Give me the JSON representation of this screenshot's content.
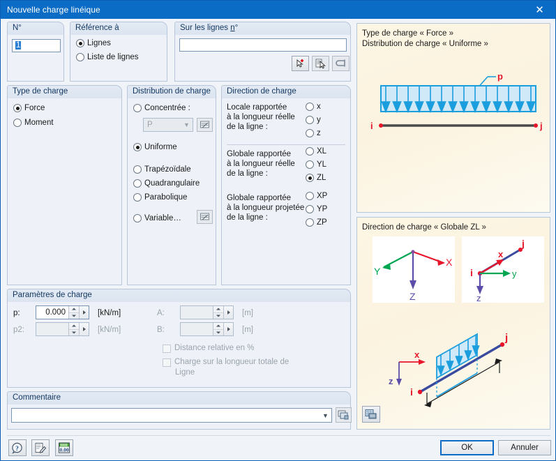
{
  "window": {
    "title": "Nouvelle charge linéique",
    "close_icon": "close-icon"
  },
  "groups": {
    "number": {
      "title": "N°",
      "value": "1"
    },
    "reference": {
      "title": "Référence à",
      "options": [
        {
          "label": "Lignes",
          "selected": true
        },
        {
          "label": "Liste de lignes",
          "selected": false
        }
      ]
    },
    "on_lines": {
      "title": "Sur les lignes n°",
      "value": "",
      "tools": [
        {
          "icon": "pick-new-line-icon"
        },
        {
          "icon": "pick-line-from-list-icon"
        },
        {
          "icon": "select-chain-icon"
        }
      ]
    },
    "load_type": {
      "title": "Type de charge",
      "options": [
        {
          "label": "Force",
          "selected": true
        },
        {
          "label": "Moment",
          "selected": false
        }
      ]
    },
    "load_distribution": {
      "title": "Distribution de charge",
      "options": [
        {
          "label": "Concentrée :",
          "selected": false
        },
        {
          "label": "Uniforme",
          "selected": true
        },
        {
          "label": "Trapézoïdale",
          "selected": false
        },
        {
          "label": "Quadrangulaire",
          "selected": false
        },
        {
          "label": "Parabolique",
          "selected": false
        },
        {
          "label": "Variable…",
          "selected": false
        }
      ],
      "concentrated_combo": {
        "value": "P",
        "enabled": false
      },
      "concentrated_button_icon": "load-diagram-icon",
      "variable_button_icon": "load-diagram-icon"
    },
    "load_direction": {
      "title": "Direction de charge",
      "sections": [
        {
          "label_lines": [
            "Locale rapportée",
            "à la longueur réelle",
            "de la ligne :"
          ],
          "options": [
            {
              "label": "x",
              "selected": false
            },
            {
              "label": "y",
              "selected": false
            },
            {
              "label": "z",
              "selected": false
            }
          ]
        },
        {
          "label_lines": [
            "Globale rapportée",
            "à la longueur réelle",
            "de la ligne :"
          ],
          "options": [
            {
              "label": "XL",
              "selected": false
            },
            {
              "label": "YL",
              "selected": false
            },
            {
              "label": "ZL",
              "selected": true
            }
          ]
        },
        {
          "label_lines": [
            "Globale rapportée",
            "à la longueur projetée",
            "de la ligne :"
          ],
          "options": [
            {
              "label": "XP",
              "selected": false
            },
            {
              "label": "YP",
              "selected": false
            },
            {
              "label": "ZP",
              "selected": false
            }
          ]
        }
      ]
    },
    "load_parameters": {
      "title": "Paramètres de charge",
      "fields": [
        {
          "label": "p:",
          "value": "0.000",
          "unit": "[kN/m]",
          "enabled": true
        },
        {
          "label": "p2:",
          "value": "",
          "unit": "[kN/m]",
          "enabled": false
        },
        {
          "label": "A:",
          "value": "",
          "unit": "[m]",
          "enabled": false
        },
        {
          "label": "B:",
          "value": "",
          "unit": "[m]",
          "enabled": false
        }
      ],
      "checkboxes": [
        {
          "label": "Distance relative en %",
          "checked": false
        },
        {
          "label": "Charge sur la longueur totale de",
          "checked": false
        }
      ],
      "checkbox_sub_label": "Ligne"
    },
    "comment": {
      "title": "Commentaire",
      "value": "",
      "dropdown_arrow_icon": "chevron-down-icon",
      "button_icon": "comment-library-icon"
    }
  },
  "preview_top": {
    "line1": "Type de charge « Force »",
    "line2": "Distribution de charge « Uniforme »",
    "load_label": "p",
    "node_start": "i",
    "node_end": "j",
    "arrow_count": 14
  },
  "preview_bottom": {
    "title": "Direction de charge « Globale ZL »",
    "global_axes": {
      "x": "X",
      "y": "Y",
      "z": "Z"
    },
    "local_axes": {
      "x": "x",
      "y": "y",
      "z": "z",
      "node_start": "i",
      "node_end": "j"
    },
    "iso": {
      "x": "x",
      "z": "z",
      "node_start": "i",
      "node_end": "j"
    },
    "button_icon": "render-view-icon"
  },
  "footer": {
    "tools": [
      {
        "icon": "help-icon"
      },
      {
        "icon": "notes-icon"
      },
      {
        "icon": "units-icon"
      }
    ],
    "ok_label": "OK",
    "cancel_label": "Annuler"
  },
  "colors": {
    "title_bar": "#0a6cc4",
    "accent": "#0a6cc4",
    "group_bg": "#eef2f8",
    "preview_bg": "#fdf6e4",
    "load_blue": "#1b9ede",
    "node_red": "#e8162b",
    "axis_green": "#00a651",
    "axis_purple": "#5b4ea8"
  }
}
